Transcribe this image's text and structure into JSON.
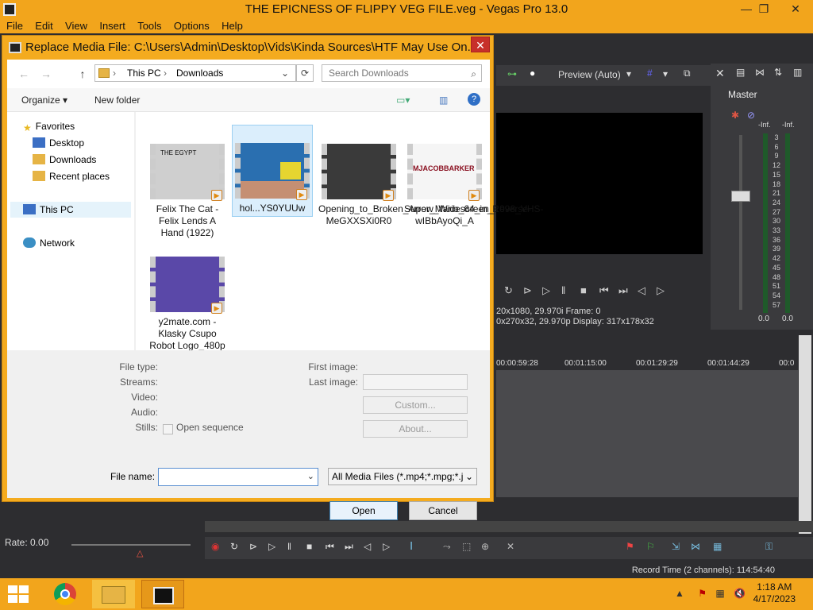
{
  "app": {
    "title": "THE EPICNESS OF FLIPPY VEG FILE.veg - Vegas Pro 13.0",
    "menu": [
      "File",
      "Edit",
      "View",
      "Insert",
      "Tools",
      "Options",
      "Help"
    ],
    "preview_mode": "Preview (Auto)",
    "preview_info_line1": "20x1080, 29.970i   Frame:     0",
    "preview_info_line2": "0x270x32, 29.970p  Display:  317x178x32",
    "master_label": "Master",
    "meter_inf_left": "-Inf.",
    "meter_inf_right": "-Inf.",
    "meter_scale": [
      "3",
      "6",
      "9",
      "12",
      "15",
      "18",
      "21",
      "24",
      "27",
      "30",
      "33",
      "36",
      "39",
      "42",
      "45",
      "48",
      "51",
      "54",
      "57"
    ],
    "meter_bottom_left": "0.0",
    "meter_bottom_right": "0.0",
    "ruler": [
      "00:00:59:28",
      "00:01:15:00",
      "00:01:29:29",
      "00:01:44:29",
      "00:0"
    ],
    "rate": "Rate: 0.00",
    "record_time": "Record Time (2 channels): 114:54:40"
  },
  "dialog": {
    "title": "Replace Media File: C:\\Users\\Admin\\Desktop\\Vids\\Kinda Sources\\HTF May Use On...",
    "close_label": "✕",
    "address": [
      "This PC",
      "Downloads"
    ],
    "search_placeholder": "Search Downloads",
    "organize_label": "Organize ▾",
    "new_folder_label": "New folder",
    "nav": {
      "favorites": "Favorites",
      "desktop": "Desktop",
      "downloads": "Downloads",
      "recent": "Recent places",
      "this_pc": "This PC",
      "network": "Network"
    },
    "files": [
      {
        "name": "Felix The Cat - Felix Lends A Hand (1922)",
        "color": "#cfcfcf"
      },
      {
        "name": "hol...YS0YUUw",
        "color": "#2a6fb0"
      },
      {
        "name": "Opening_to_Broken_Arrow_Widescreen_1998_VHS-MeGXXSXi0R0",
        "color": "#3a3a3a"
      },
      {
        "name": "Super_Mario_64_in_Reverse-wIBbAyoQi_A",
        "color": "#f5f5f5"
      },
      {
        "name": "y2mate.com - Klasky Csupo Robot Logo_480p",
        "color": "#5a48a8"
      }
    ],
    "thumb_text": {
      "felix": "THE EGYPT",
      "mario": "MJACOBBARKER"
    },
    "details": {
      "file_type": "File type:",
      "streams": "Streams:",
      "video": "Video:",
      "audio": "Audio:",
      "stills": "Stills:",
      "open_sequence": "Open sequence",
      "first_image": "First image:",
      "last_image": "Last image:",
      "custom": "Custom...",
      "about": "About..."
    },
    "file_name_label": "File name:",
    "file_name_value": "",
    "filter": "All Media Files (*.mp4;*.mpg;*.j",
    "open_label": "Open",
    "cancel_label": "Cancel"
  },
  "taskbar": {
    "time": "1:18 AM",
    "date": "4/17/2023"
  }
}
